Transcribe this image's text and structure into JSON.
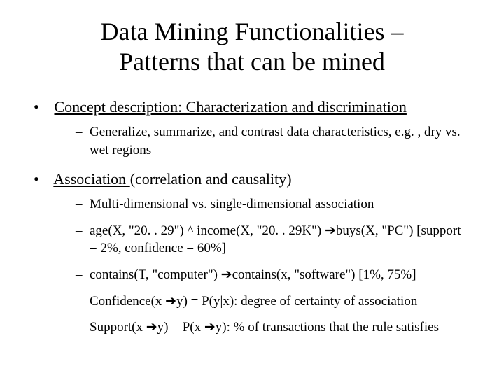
{
  "title_line1": "Data Mining Functionalities –",
  "title_line2": "Patterns that can be mined",
  "bullets": [
    {
      "heading_underlined": "Concept description: Characterization and discrimination",
      "heading_rest": "",
      "subs": [
        "Generalize, summarize, and contrast data characteristics, e.g. , dry vs. wet regions"
      ]
    },
    {
      "heading_underlined": "Association ",
      "heading_rest": "(correlation and causality)",
      "subs": [
        "Multi-dimensional vs. single-dimensional association",
        "age(X, \"20. . 29\") ^ income(X, \"20. . 29K\") ➔buys(X, \"PC\") [support = 2%, confidence = 60%]",
        "contains(T, \"computer\") ➔contains(x, \"software\") [1%, 75%]",
        "Confidence(x ➔y) = P(y|x):  degree of certainty of association",
        "Support(x ➔y) = P(x ➔y):  % of transactions that the rule satisfies"
      ]
    }
  ]
}
